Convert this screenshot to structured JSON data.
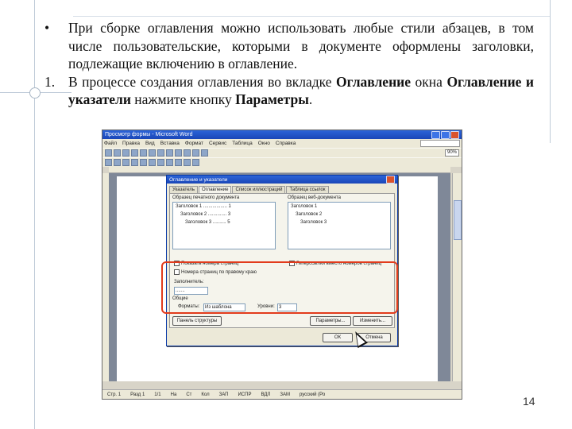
{
  "bullet_marker": "•",
  "paragraph1": "При сборке оглавления можно использовать любые стили абзацев, в том числе пользовательские, которыми в документе оформлены заголовки, подлежащие включению в оглавление.",
  "step_marker": "1.",
  "paragraph2": {
    "t1": "В процессе создания оглавления во вкладке ",
    "b1": "Оглавление",
    "t2": " окна ",
    "b2": "Оглавление и указатели",
    "t3": "  нажмите кнопку ",
    "b3": "Параметры",
    "t4": "."
  },
  "page_number": "14",
  "screenshot": {
    "window_title": "Просмотр формы - Microsoft Word",
    "menu": [
      "Файл",
      "Правка",
      "Вид",
      "Вставка",
      "Формат",
      "Сервис",
      "Таблица",
      "Окно",
      "Справка"
    ],
    "zoom": "90%",
    "dialog_title": "Оглавление и указатели",
    "tabs": [
      "Указатель",
      "Оглавление",
      "Список иллюстраций",
      "Таблица ссылок"
    ],
    "print_preview_label": "Образец печатного документа",
    "web_preview_label": "Образец веб-документа",
    "print_lines": [
      "Заголовок 1 .................. 1",
      "Заголовок 2 .............. 3",
      "Заголовок 3 .......... 5"
    ],
    "web_lines": [
      "Заголовок 1",
      "Заголовок 2",
      "Заголовок 3"
    ],
    "chk_page_numbers": "Показать номера страниц",
    "chk_right_align": "Номера страниц по правому краю",
    "chk_hyperlinks": "Гиперссылки вместо номеров страниц",
    "filler_label": "Заполнитель:",
    "filler_value": ".......",
    "general_label": "Общие",
    "formats_label": "Форматы:",
    "formats_value": "Из шаблона",
    "levels_label": "Уровни:",
    "levels_value": "3",
    "btn_toolbar": "Панель структуры",
    "btn_params": "Параметры...",
    "btn_change": "Изменить...",
    "btn_ok": "ОК",
    "btn_cancel": "Отмена",
    "status": [
      "Стр. 1",
      "Разд 1",
      "1/1",
      "На",
      "Ст",
      "Кол",
      "ЗАП",
      "ИСПР",
      "ВДЛ",
      "ЗАМ",
      "русский (Ро"
    ]
  }
}
